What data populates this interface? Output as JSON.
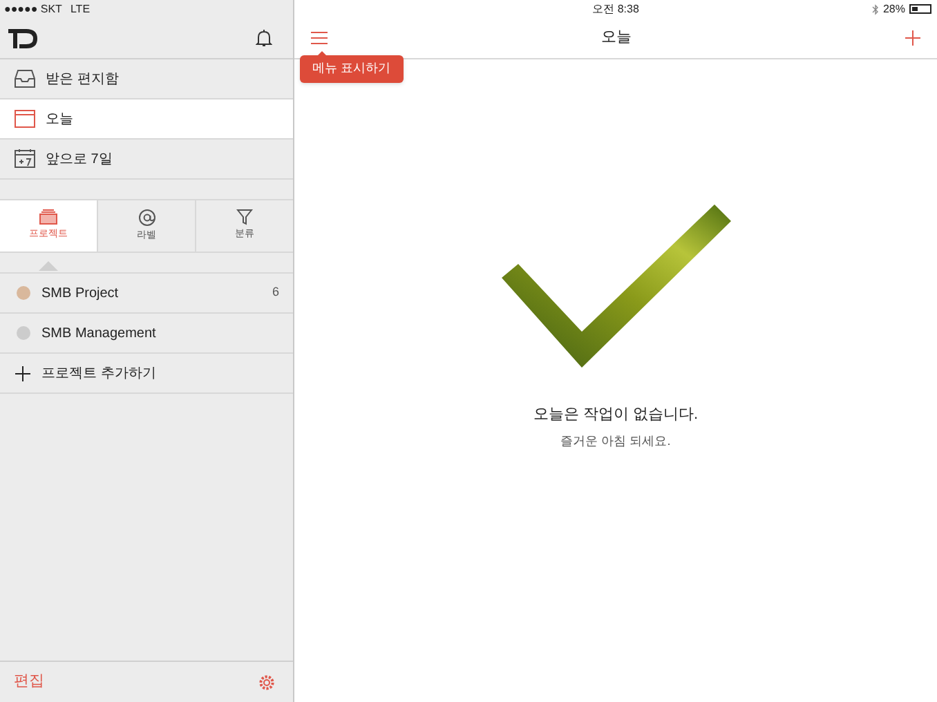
{
  "status_bar": {
    "carrier": "●●●●● SKT",
    "network": "LTE",
    "time": "오전 8:38",
    "battery": "28%"
  },
  "sidebar": {
    "nav": [
      {
        "label": "받은 편지함",
        "selected": false
      },
      {
        "label": "오늘",
        "selected": true
      },
      {
        "label": "앞으로 7일",
        "selected": false
      }
    ],
    "tabs": [
      {
        "label": "프로젝트",
        "selected": true
      },
      {
        "label": "라벨",
        "selected": false
      },
      {
        "label": "분류",
        "selected": false
      }
    ],
    "projects": [
      {
        "name": "SMB Project",
        "color": "#d9b89c",
        "count": "6"
      },
      {
        "name": "SMB Management",
        "color": "#cccccc"
      }
    ],
    "add_project": "프로젝트 추가하기",
    "edit": "편집"
  },
  "main": {
    "title": "오늘",
    "tooltip": "메뉴 표시하기",
    "empty_title": "오늘은 작업이 없습니다.",
    "empty_subtitle": "즐거운 아침 되세요."
  }
}
